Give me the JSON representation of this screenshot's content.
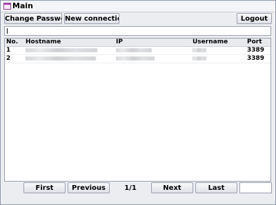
{
  "window": {
    "title": "Main"
  },
  "toolbar": {
    "change_password": "Change Password",
    "new_connection": "New connection",
    "logout": "Logout"
  },
  "search": {
    "value": "",
    "placeholder": ""
  },
  "table": {
    "columns": [
      "No.",
      "Hostname",
      "IP",
      "Username",
      "Port"
    ],
    "rows": [
      {
        "no": "1",
        "port": "3389"
      },
      {
        "no": "2",
        "port": "3389"
      }
    ]
  },
  "pager": {
    "first": "First",
    "previous": "Previous",
    "page": "1/1",
    "next": "Next",
    "last": "Last",
    "goto_value": ""
  },
  "icons": {
    "window": "window-icon"
  }
}
